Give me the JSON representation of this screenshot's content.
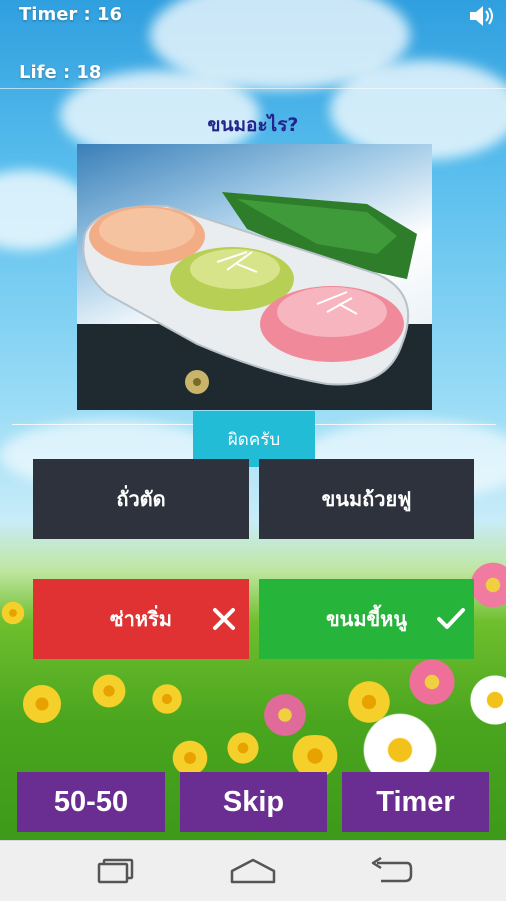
{
  "hud": {
    "timer_text": "Timer  : 16",
    "life_text": "Life : 18",
    "sound_icon": "speaker-icon"
  },
  "question": {
    "text": "ขนมอะไร?"
  },
  "image": {
    "description": "food-photo"
  },
  "result": {
    "label": "ผิดครับ"
  },
  "answers": [
    {
      "label": "ถั่วตัด",
      "state": "normal"
    },
    {
      "label": "ขนมถ้วยฟู",
      "state": "normal"
    },
    {
      "label": "ซ่าหริ่ม",
      "state": "wrong",
      "icon": "close-icon"
    },
    {
      "label": "ขนมขี้หนู",
      "state": "correct",
      "icon": "check-icon"
    }
  ],
  "lifelines": {
    "fifty": "50-50",
    "skip": "Skip",
    "timer": "Timer"
  },
  "colors": {
    "result_bg": "#22bcd6",
    "answer_dark": "#2d323c",
    "wrong": "#e03232",
    "correct": "#26b43a",
    "lifeline": "#6a2d91",
    "question_text": "#24248c"
  },
  "navbar": {
    "icons": [
      "recent-apps-icon",
      "home-icon",
      "back-icon"
    ]
  }
}
